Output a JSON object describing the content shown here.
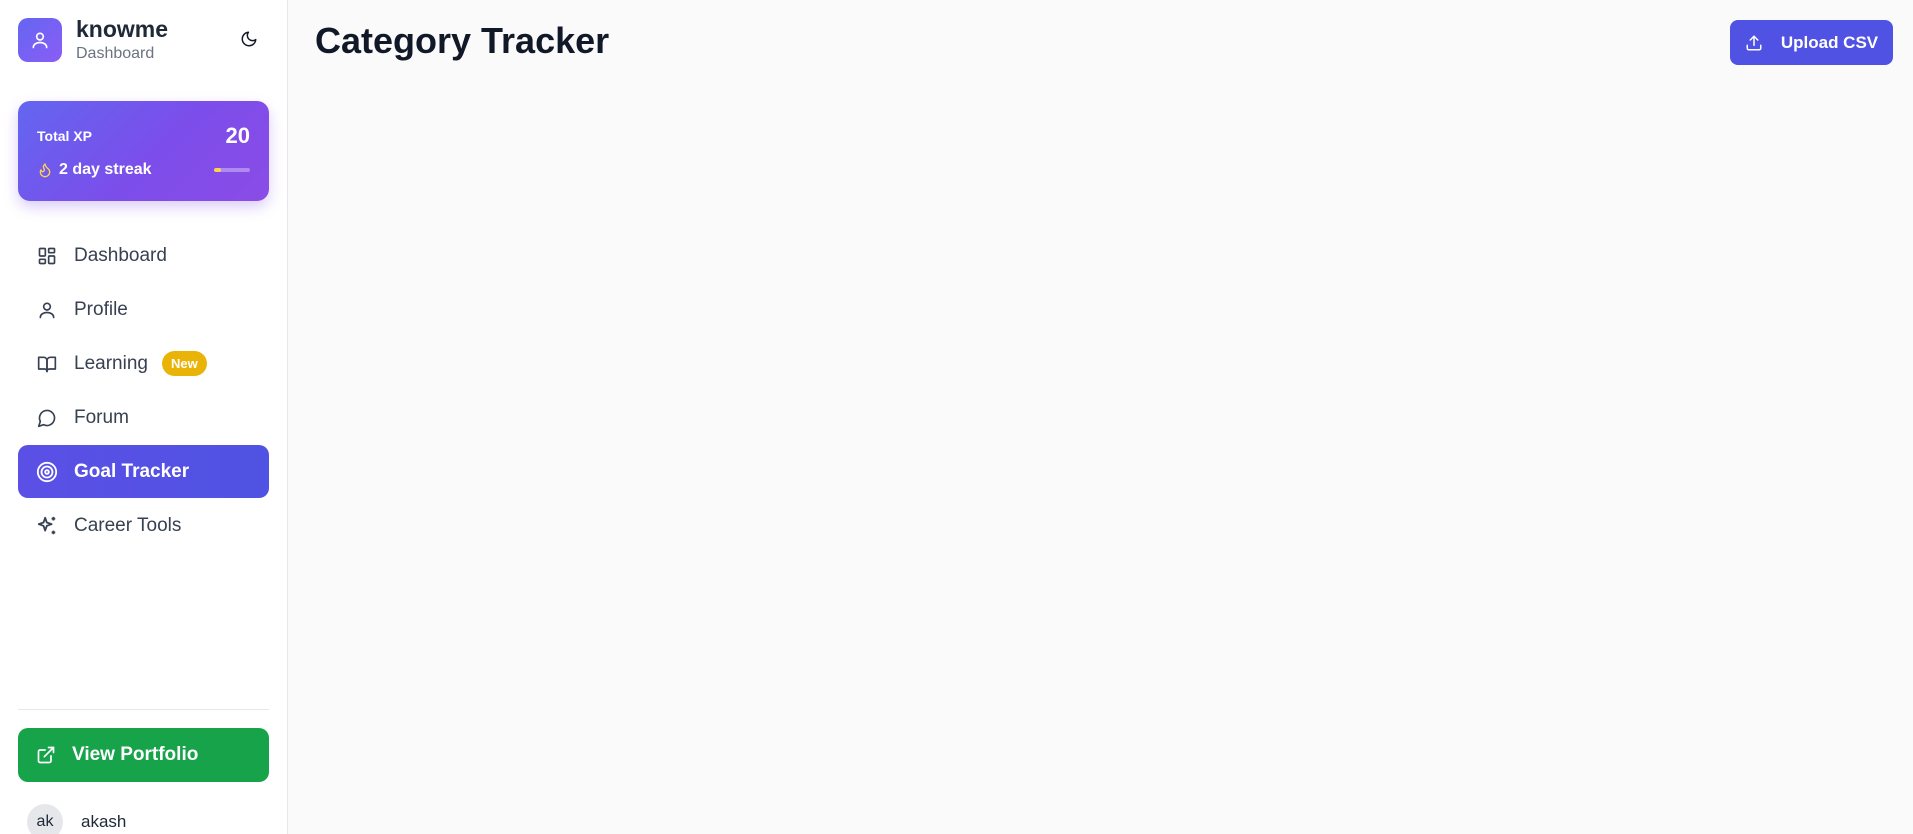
{
  "brand": {
    "name": "knowme",
    "subtitle": "Dashboard",
    "logo_icon": "user-icon",
    "accent": "#6366f1"
  },
  "theme_toggle": {
    "icon": "moon-icon"
  },
  "xp_card": {
    "label": "Total XP",
    "value": "20",
    "streak_text": "2 day streak",
    "streak_icon": "flame-icon",
    "progress_fraction": 0.2,
    "progress_color": "#fcd34d"
  },
  "nav": {
    "items": [
      {
        "label": "Dashboard",
        "icon": "dashboard-grid-icon",
        "active": false
      },
      {
        "label": "Profile",
        "icon": "user-icon",
        "active": false
      },
      {
        "label": "Learning",
        "icon": "book-open-icon",
        "active": false,
        "badge": "New"
      },
      {
        "label": "Forum",
        "icon": "message-circle-icon",
        "active": false
      },
      {
        "label": "Goal Tracker",
        "icon": "target-icon",
        "active": true
      },
      {
        "label": "Career Tools",
        "icon": "sparkles-icon",
        "active": false
      }
    ],
    "active_color": "#4f52e2",
    "badge_color": "#eab308"
  },
  "portfolio": {
    "label": "View Portfolio",
    "icon": "external-link-icon",
    "color": "#16a34a"
  },
  "user": {
    "initials": "ak",
    "name": "akash"
  },
  "main": {
    "title": "Category Tracker",
    "upload_label": "Upload CSV",
    "upload_icon": "upload-icon"
  }
}
